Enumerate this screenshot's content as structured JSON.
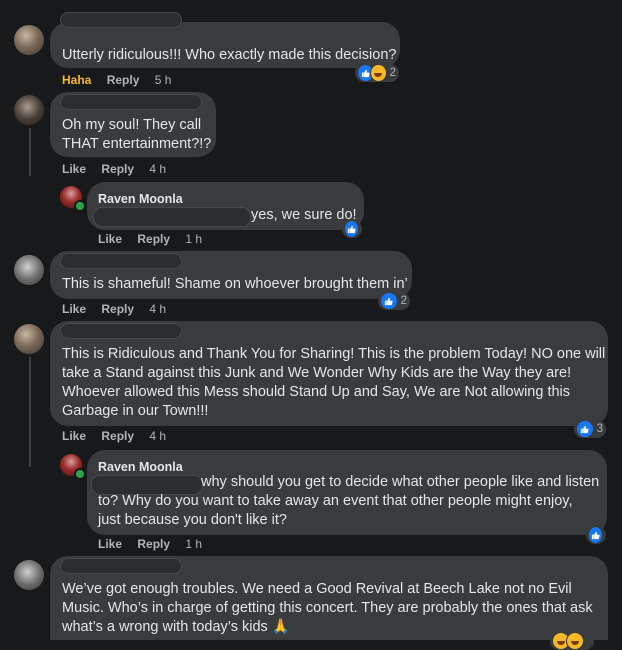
{
  "comments": [
    {
      "text": "Utterly ridiculous!!! Who exactly made this decision?",
      "reaction_label": "Haha",
      "reply": "Reply",
      "time": "5 h",
      "reaction_count": "2"
    },
    {
      "text_line1": "Oh my soul! They call",
      "text_line2": "THAT entertainment?!?",
      "like": "Like",
      "reply": "Reply",
      "time": "4 h"
    },
    {
      "author": "Raven Moonla",
      "text": "yes, we sure do!",
      "like": "Like",
      "reply": "Reply",
      "time": "1 h"
    },
    {
      "text": "This is shameful! Shame on whoever brought them in’",
      "like": "Like",
      "reply": "Reply",
      "time": "4 h",
      "reaction_count": "2"
    },
    {
      "text_line1": "This is Ridiculous and Thank You for Sharing! This is the problem Today! NO one will",
      "text_line2": "take a Stand against this Junk and We Wonder Why Kids are the Way they are!",
      "text_line3": "Whoever allowed this Mess should Stand Up and Say, We are Not allowing this",
      "text_line4": "Garbage in our Town!!!",
      "like": "Like",
      "reply": "Reply",
      "time": "4 h",
      "reaction_count": "3"
    },
    {
      "author": "Raven Moonla",
      "text_line1": "why should you get to decide what other people like and listen",
      "text_line2": "to? Why do you want to take away an event that other people might enjoy,",
      "text_line3": "just because you don't like it?",
      "like": "Like",
      "reply": "Reply",
      "time": "1 h"
    },
    {
      "text_line1": "We’ve got enough troubles. We need a Good Revival at Beech Lake not no Evil",
      "text_line2": "Music. Who’s in charge of getting this concert. They are probably the ones that ask",
      "text_line3": "what’s a wrong with today’s kids 🙏"
    }
  ],
  "colors": {
    "background": "#18191a",
    "bubble": "#3a3b3c",
    "text": "#e4e6eb",
    "meta": "#b0b3b8",
    "like_blue": "#1877f2",
    "haha_yellow": "#f7b928",
    "online_green": "#31a24c"
  },
  "icons": [
    "like-icon",
    "haha-icon",
    "online-status-dot"
  ]
}
